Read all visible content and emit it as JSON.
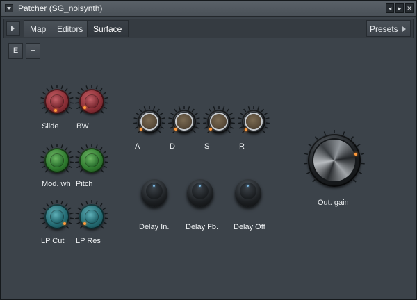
{
  "window": {
    "title": "Patcher (SG_noisynth)",
    "controls": [
      "◂",
      "▸",
      "✕"
    ]
  },
  "tabs": [
    {
      "label": "Map",
      "active": false
    },
    {
      "label": "Editors",
      "active": false
    },
    {
      "label": "Surface",
      "active": true
    }
  ],
  "presets_label": "Presets",
  "buttons": {
    "e_label": "E",
    "plus_label": "+"
  },
  "knobs": {
    "slide": {
      "label": "Slide",
      "color": "red"
    },
    "bw": {
      "label": "BW",
      "color": "red"
    },
    "mod_wh": {
      "label": "Mod. wh",
      "color": "green"
    },
    "pitch": {
      "label": "Pitch",
      "color": "green"
    },
    "lp_cut": {
      "label": "LP Cut",
      "color": "teal"
    },
    "lp_res": {
      "label": "LP Res",
      "color": "teal"
    },
    "a": {
      "label": "A"
    },
    "d": {
      "label": "D"
    },
    "s": {
      "label": "S"
    },
    "r": {
      "label": "R"
    },
    "delay_in": {
      "label": "Delay In."
    },
    "delay_fb": {
      "label": "Delay Fb."
    },
    "delay_off": {
      "label": "Delay Off"
    },
    "out_gain": {
      "label": "Out. gain"
    }
  },
  "colors": {
    "background": "#3c434a",
    "titlebar": "#4f565d",
    "indicator": "#ff9a3c",
    "red_knob": "#8a2e36",
    "green_knob": "#2e7a2e",
    "teal_knob": "#236a72"
  }
}
